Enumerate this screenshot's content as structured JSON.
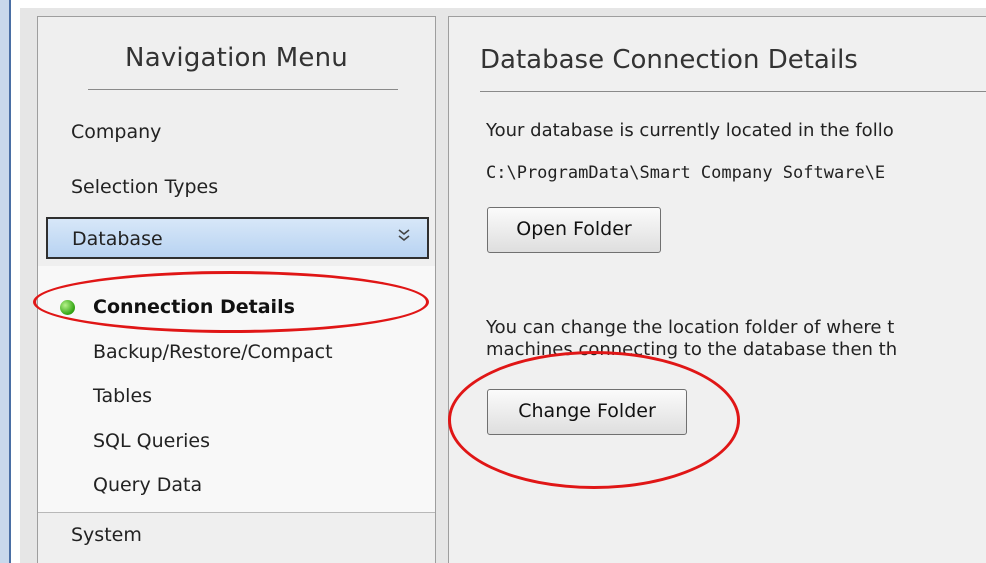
{
  "nav": {
    "title": "Navigation Menu",
    "items": [
      {
        "label": "Company"
      },
      {
        "label": "Selection Types"
      }
    ],
    "database": {
      "label": "Database",
      "chevron": "»"
    },
    "sub_items": [
      {
        "label": "Connection Details",
        "active": true
      },
      {
        "label": "Backup/Restore/Compact"
      },
      {
        "label": "Tables"
      },
      {
        "label": "SQL Queries"
      },
      {
        "label": "Query Data"
      }
    ],
    "system": {
      "label": "System"
    }
  },
  "main": {
    "title": "Database Connection Details",
    "location_text": "Your database is currently located in the follo",
    "path": "C:\\ProgramData\\Smart Company Software\\E",
    "open_folder_label": "Open Folder",
    "change_text_line1": "You can change the location folder of where t",
    "change_text_line2": "machines connecting to the database then th",
    "change_folder_label": "Change Folder"
  },
  "colors": {
    "annotation": "#e01616",
    "active_dot": "#38a818",
    "selected_row": "#b8d3f2"
  }
}
